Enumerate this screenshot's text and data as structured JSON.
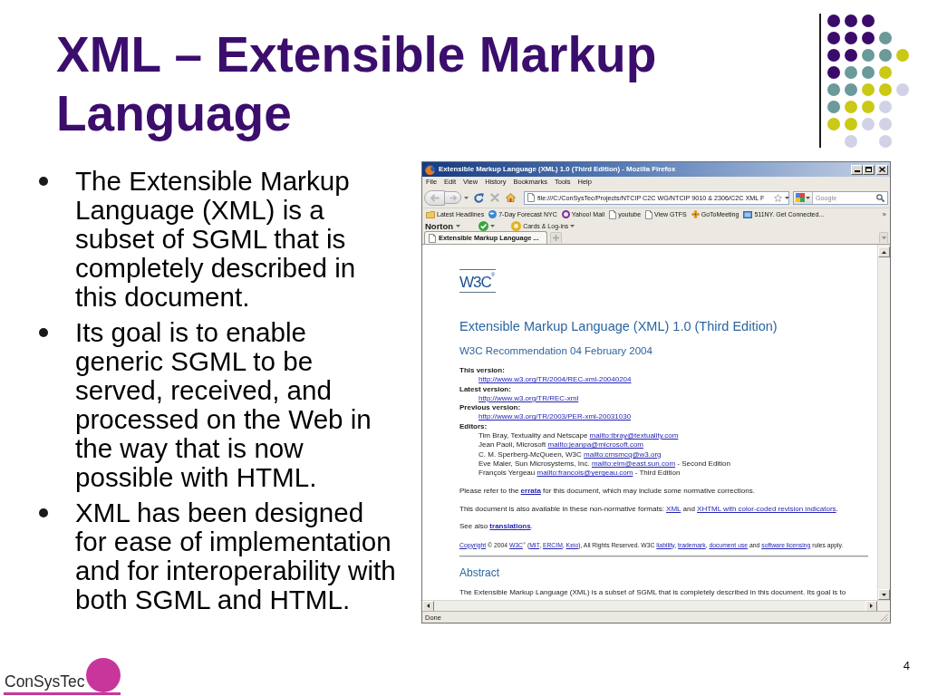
{
  "slide": {
    "title": "XML – Extensible Markup Language",
    "bullets": [
      "The Extensible Markup Language (XML) is a subset of SGML that is completely described in this document.",
      "Its goal is to enable generic SGML to be served, received, and processed on the Web in the way that is now possible with HTML.",
      "XML has been designed for ease of implementation and for interoperability with both SGML and HTML."
    ]
  },
  "browser": {
    "window_title": "Extensible Markup Language (XML) 1.0 (Third Edition) - Mozilla Firefox",
    "menu": [
      "File",
      "Edit",
      "View",
      "History",
      "Bookmarks",
      "Tools",
      "Help"
    ],
    "navigation": {
      "back": {
        "disabled": true
      },
      "forward": {
        "disabled": true
      },
      "stop": {
        "disabled": true
      }
    },
    "address": {
      "value": "file:///C:/ConSysTec/Projects/NTCIP C2C WG/NTCIP 9010 & 2306/C2C XML F"
    },
    "search": {
      "placeholder": "Google"
    },
    "bookmarks": [
      {
        "kind": "folder",
        "label": "Latest Headlines"
      },
      {
        "kind": "weather",
        "label": "7-Day Forecast NYC"
      },
      {
        "kind": "mail",
        "label": "Yahoo! Mail"
      },
      {
        "kind": "page",
        "label": "youtube"
      },
      {
        "kind": "page",
        "label": "View GTFS"
      },
      {
        "kind": "meeting",
        "label": "GoToMeeting"
      },
      {
        "kind": "site",
        "label": "511NY. Get Connected..."
      }
    ],
    "bookmarks_more": "»",
    "norton_toolbar": {
      "brand": "Norton",
      "cards": "Cards & Log-ins"
    },
    "tabs": [
      {
        "label": "Extensible Markup Language ...",
        "selected": true
      }
    ],
    "page": {
      "logo": "W3C$^{®}$",
      "title": "Extensible Markup Language (XML) 1.0 (Third Edition)",
      "subtitle": "W3C Recommendation 04 February 2004",
      "versions": [
        {
          "label": "This version:",
          "url": "http://www.w3.org/TR/2004/REC-xml-20040204"
        },
        {
          "label": "Latest version:",
          "url": "http://www.w3.org/TR/REC-xml"
        },
        {
          "label": "Previous version:",
          "url": "http://www.w3.org/TR/2003/PER-xml-20031030"
        }
      ],
      "editors": {
        "label": "Editors:",
        "people": [
          {
            "name": "Tim Bray, Textuality and Netscape",
            "email": "mailto:tbray@textuality.com"
          },
          {
            "name": "Jean Paoli, Microsoft",
            "email": "mailto:jeanpa@microsoft.com"
          },
          {
            "name": "C. M. Sperberg-McQueen, W3C",
            "email": "mailto:cmsmcq@w3.org"
          },
          {
            "name": "Eve Maler, Sun Microsystems, Inc.",
            "email": "mailto:elm@east.sun.com",
            "note": "- Second Edition"
          },
          {
            "name": "François Yergeau",
            "email": "mailto:francois@yergeau.com",
            "note": "- Third Edition"
          }
        ]
      },
      "paragraphs": [
        {
          "kind": "normal",
          "parts": [
            {
              "kind": "text",
              "text": "Please refer to the "
            },
            {
              "kind": "link",
              "text": "errata",
              "bold": true
            },
            {
              "kind": "text",
              "text": " for this document, which may include some normative corrections."
            }
          ]
        },
        {
          "kind": "normal",
          "parts": [
            {
              "kind": "text",
              "text": "This document is also available in these non-normative formats: "
            },
            {
              "kind": "link",
              "text": "XML",
              "bold": false
            },
            {
              "kind": "text",
              "text": " and "
            },
            {
              "kind": "link",
              "text": "XHTML with color-coded revision indicators",
              "bold": false
            },
            {
              "kind": "text",
              "text": "."
            }
          ]
        },
        {
          "kind": "normal",
          "parts": [
            {
              "kind": "text",
              "text": "See also "
            },
            {
              "kind": "link",
              "text": "translations",
              "bold": true
            },
            {
              "kind": "text",
              "text": "."
            }
          ]
        },
        {
          "kind": "fine_print",
          "parts": [
            {
              "kind": "link",
              "text": "Copyright",
              "bold": false
            },
            {
              "kind": "text",
              "text": " © 2004 "
            },
            {
              "kind": "link",
              "text": "W3C",
              "bold": false
            },
            {
              "kind": "text",
              "text": "$^{®}$ ("
            },
            {
              "kind": "link",
              "text": "MIT",
              "bold": false
            },
            {
              "kind": "text",
              "text": ", "
            },
            {
              "kind": "link",
              "text": "ERCIM",
              "bold": false
            },
            {
              "kind": "text",
              "text": ", "
            },
            {
              "kind": "link",
              "text": "Keio",
              "bold": false
            },
            {
              "kind": "text",
              "text": "), All Rights Reserved. W3C "
            },
            {
              "kind": "link",
              "text": "liability",
              "bold": false
            },
            {
              "kind": "text",
              "text": ", "
            },
            {
              "kind": "link",
              "text": "trademark",
              "bold": false
            },
            {
              "kind": "text",
              "text": ", "
            },
            {
              "kind": "link",
              "text": "document use",
              "bold": false
            },
            {
              "kind": "text",
              "text": " and "
            },
            {
              "kind": "link",
              "text": "software licensing",
              "bold": false
            },
            {
              "kind": "text",
              "text": " rules apply."
            }
          ]
        }
      ],
      "abstract": {
        "heading": "Abstract",
        "text": "The Extensible Markup Language (XML) is a subset of SGML that is completely described in this document. Its goal is to"
      }
    },
    "status_bar": "Done"
  },
  "footer": {
    "logo": "ConSysTec",
    "page_number": "4"
  }
}
